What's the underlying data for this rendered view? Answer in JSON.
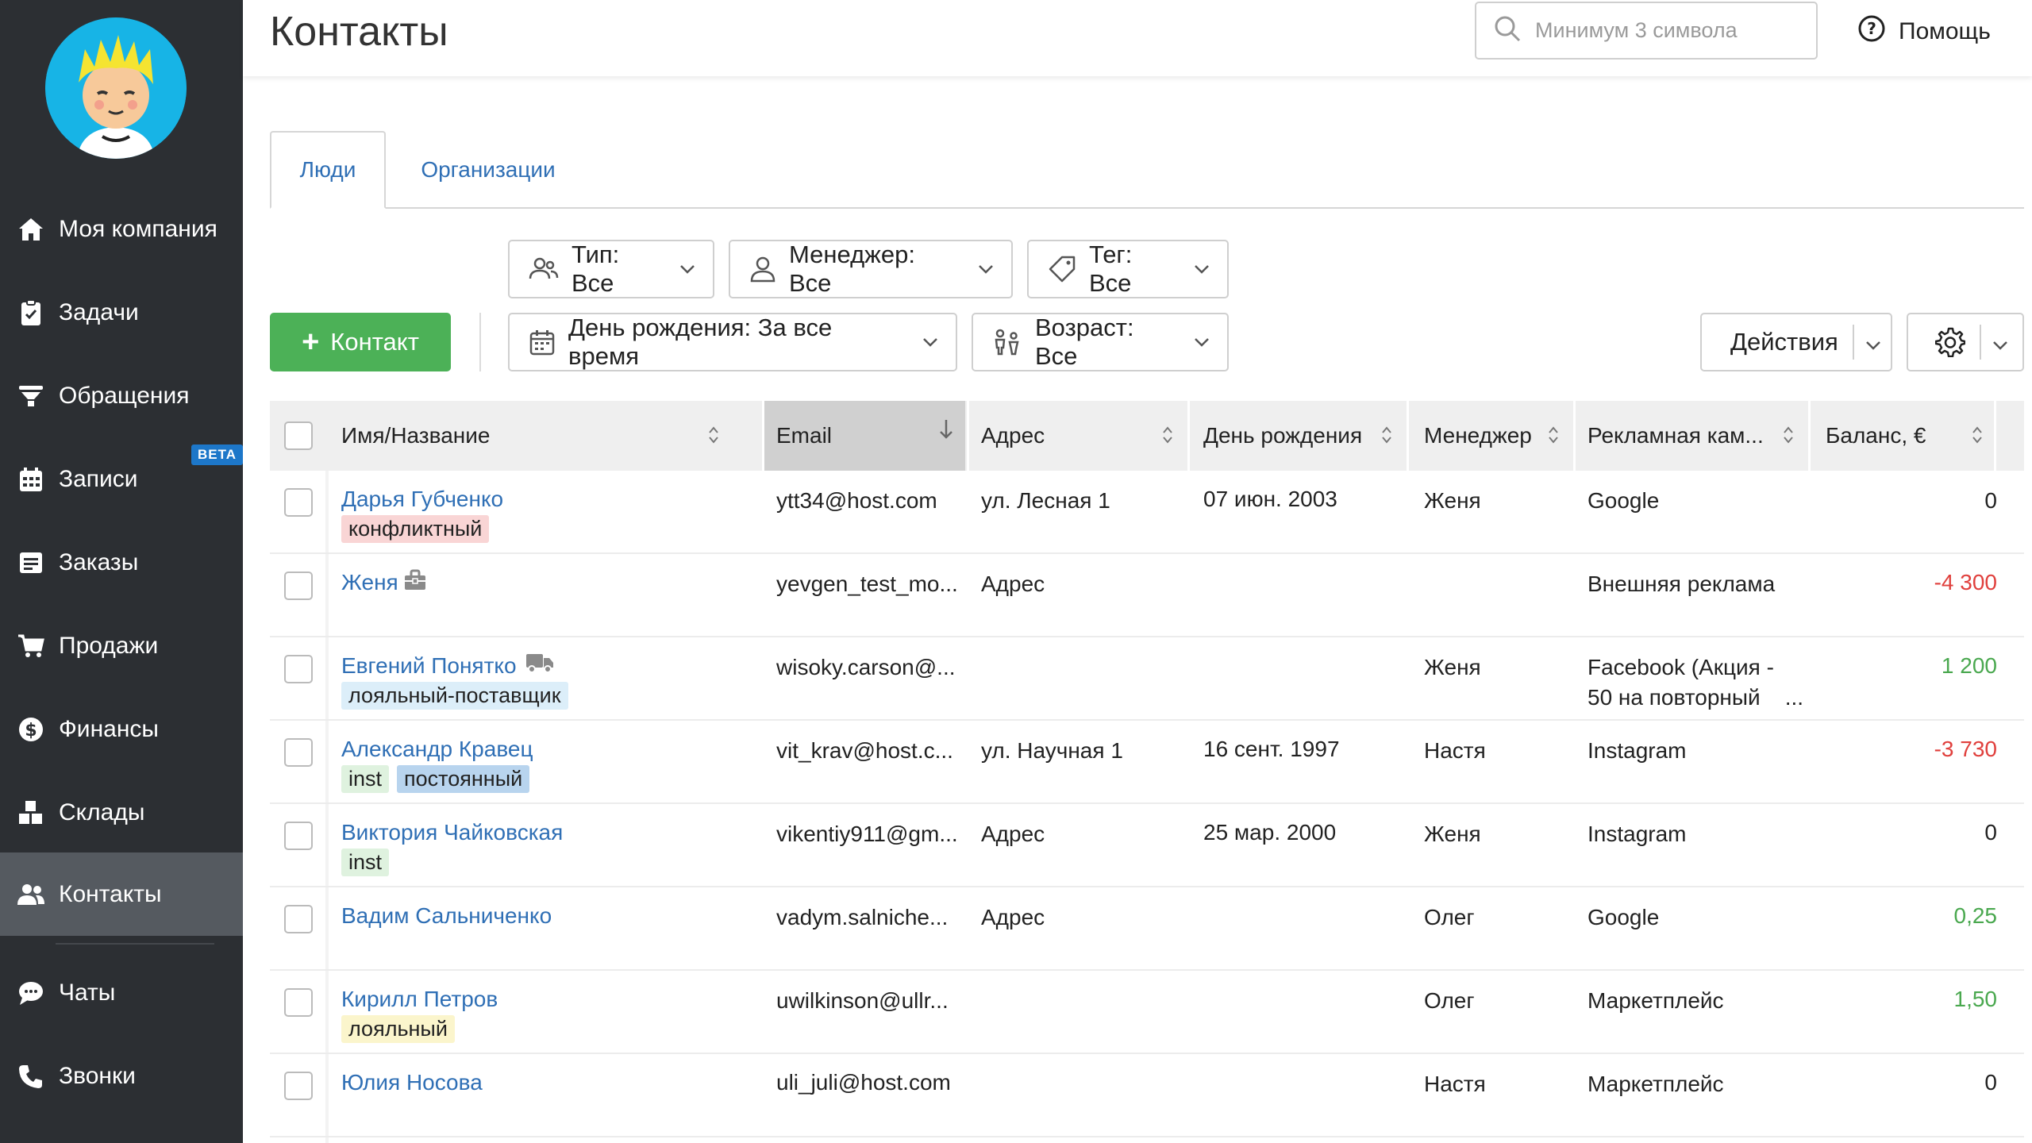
{
  "app": {
    "title": "Контакты"
  },
  "sidebar": {
    "beta": "BETA",
    "items": [
      {
        "label": "Моя компания",
        "icon": "home-icon"
      },
      {
        "label": "Задачи",
        "icon": "clipboard-check-icon"
      },
      {
        "label": "Обращения",
        "icon": "funnel-icon"
      },
      {
        "label": "Записи",
        "icon": "calendar-icon"
      },
      {
        "label": "Заказы",
        "icon": "order-list-icon"
      },
      {
        "label": "Продажи",
        "icon": "cart-icon"
      },
      {
        "label": "Финансы",
        "icon": "dollar-icon"
      },
      {
        "label": "Склады",
        "icon": "boxes-icon"
      },
      {
        "label": "Контакты",
        "icon": "users-icon"
      },
      {
        "label": "Чаты",
        "icon": "chat-icon"
      },
      {
        "label": "Звонки",
        "icon": "phone-icon"
      }
    ]
  },
  "header": {
    "search_placeholder": "Минимум 3 символа",
    "help": "Помощь"
  },
  "tabs": [
    {
      "label": "Люди"
    },
    {
      "label": "Организации"
    }
  ],
  "filters": {
    "type": "Тип: Все",
    "manager": "Менеджер: Все",
    "tag": "Тег: Все",
    "birthday": "День рождения: За все время",
    "age": "Возраст: Все"
  },
  "toolbar": {
    "add_contact": "Контакт",
    "actions": "Действия"
  },
  "table": {
    "columns": [
      "Имя/Название",
      "Email",
      "Адрес",
      "День рождения",
      "Менеджер",
      "Рекламная кам...",
      "Баланс, €"
    ],
    "rows": [
      {
        "name": "Дарья Губченко",
        "tags": [
          "конфликтный"
        ],
        "email": "ytt34@host.com",
        "address": "ул. Лесная 1",
        "birthday": "07 июн. 2003",
        "manager": "Женя",
        "campaign": "Google",
        "campaign2": "",
        "balance": "0"
      },
      {
        "name": "Женя",
        "tags": [],
        "email": "yevgen_test_mo...",
        "address": "Адрес",
        "birthday": "",
        "manager": "",
        "campaign": "Внешняя реклама",
        "campaign2": "",
        "balance": "-4 300"
      },
      {
        "name": "Евгений Понятко",
        "tags": [
          "лояльный-поставщик"
        ],
        "email": "wisoky.carson@...",
        "address": "",
        "birthday": "",
        "manager": "Женя",
        "campaign": "Facebook (Акция -",
        "campaign2": "50 на повторный    ...",
        "balance": "1 200"
      },
      {
        "name": "Александр Кравец",
        "tags": [
          "inst",
          "постоянный"
        ],
        "email": "vit_krav@host.c...",
        "address": "ул. Научная 1",
        "birthday": "16 сент. 1997",
        "manager": "Настя",
        "campaign": "Instagram",
        "campaign2": "",
        "balance": "-3 730"
      },
      {
        "name": "Виктория Чайковская",
        "tags": [
          "inst"
        ],
        "email": "vikentiy911@gm...",
        "address": "Адрес",
        "birthday": "25 мар. 2000",
        "manager": "Женя",
        "campaign": "Instagram",
        "campaign2": "",
        "balance": "0"
      },
      {
        "name": "Вадим Сальниченко",
        "tags": [],
        "email": "vadym.salniche...",
        "address": "Адрес",
        "birthday": "",
        "manager": "Олег",
        "campaign": "Google",
        "campaign2": "",
        "balance": "0,25"
      },
      {
        "name": "Кирилл Петров",
        "tags": [
          "лояльный"
        ],
        "email": "uwilkinson@ullr...",
        "address": "",
        "birthday": "",
        "manager": "Олег",
        "campaign": "Маркетплейс",
        "campaign2": "",
        "balance": "1,50"
      },
      {
        "name": "Юлия Носова",
        "tags": [],
        "email": "uli_juli@host.com",
        "address": "",
        "birthday": "",
        "manager": "Настя",
        "campaign": "Маркетплейс",
        "campaign2": "",
        "balance": "0"
      }
    ]
  },
  "colors": {
    "accent": "#2f6fb5",
    "primary_button": "#4cb157",
    "sidebar": "#2c2f33",
    "negative": "#e0403d",
    "positive": "#4aa84f"
  }
}
